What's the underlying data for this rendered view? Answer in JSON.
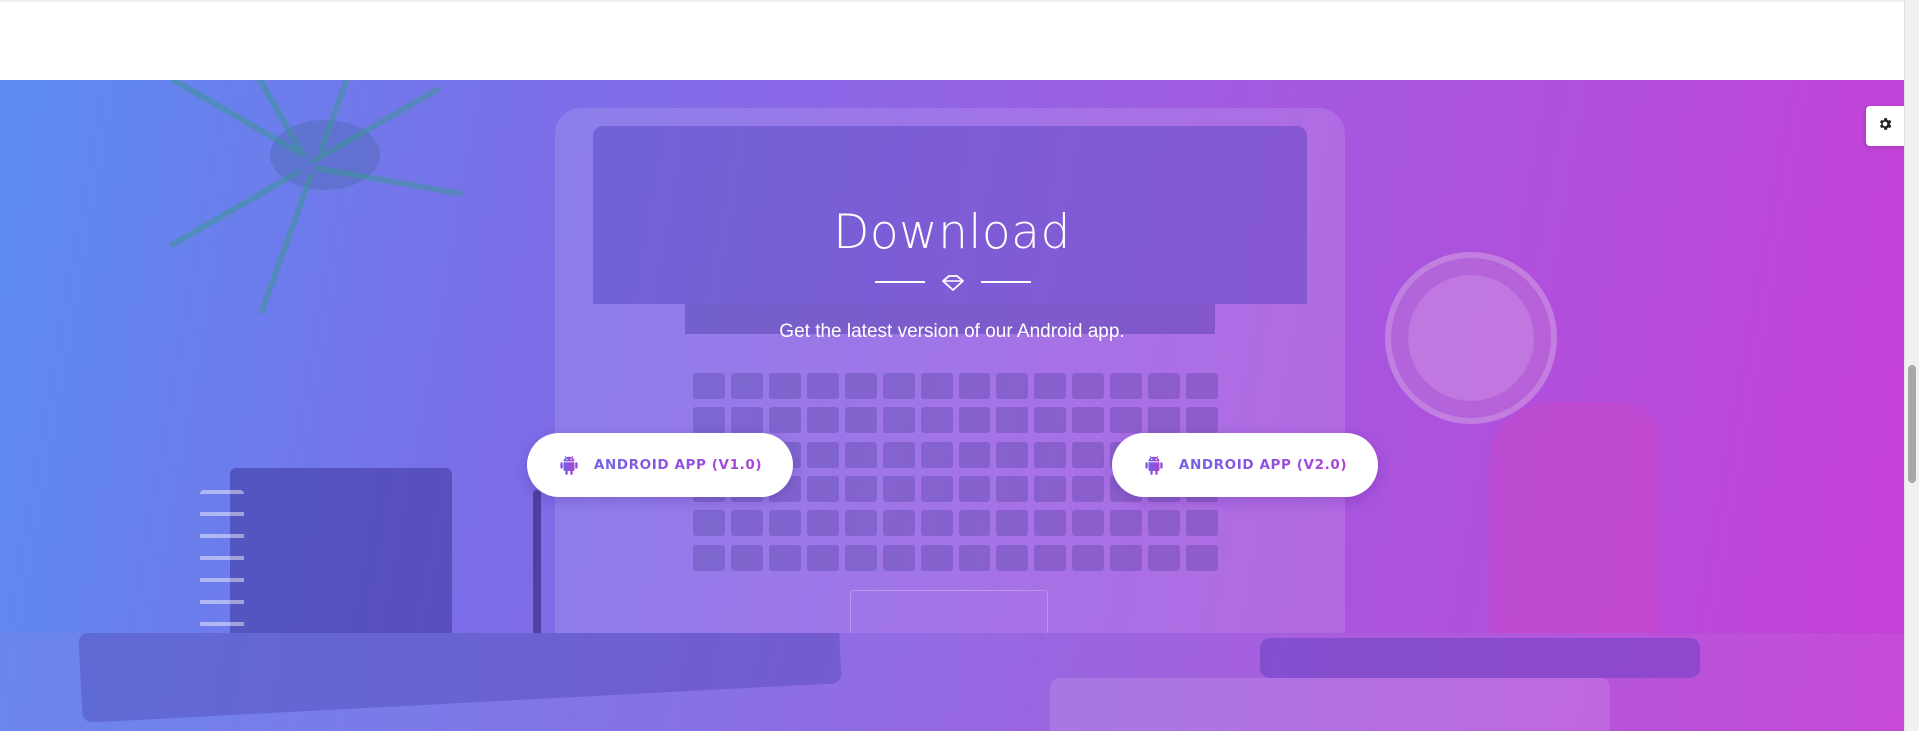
{
  "download": {
    "title": "Download",
    "subtitle": "Get the latest version of our Android app.",
    "buttons": [
      {
        "label": "ANDROID APP (V1.0)",
        "icon": "android-icon"
      },
      {
        "label": "ANDROID APP (V2.0)",
        "icon": "android-icon"
      }
    ],
    "divider_icon": "diamond-icon"
  },
  "settings_tab": {
    "icon": "gear-icon"
  },
  "colors": {
    "gradient_start": "#5b8df0",
    "gradient_end": "#c63fd6",
    "button_text_start": "#6f63e6",
    "button_text_end": "#b041d6",
    "button_background": "#ffffff"
  }
}
